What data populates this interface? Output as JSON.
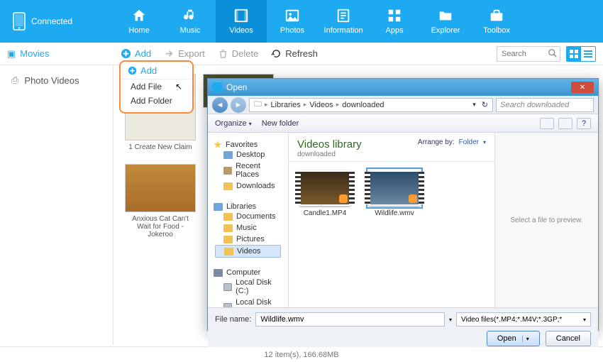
{
  "device": {
    "status": "Connected"
  },
  "nav": {
    "home": "Home",
    "music": "Music",
    "videos": "Videos",
    "photos": "Photos",
    "information": "Information",
    "apps": "Apps",
    "explorer": "Explorer",
    "toolbox": "Toolbox"
  },
  "sidebar": {
    "movies": "Movies",
    "photoVideos": "Photo Videos"
  },
  "toolbar": {
    "add": "Add",
    "export": "Export",
    "delete": "Delete",
    "refresh": "Refresh",
    "searchPlaceholder": "Search"
  },
  "addMenu": {
    "file": "Add File",
    "folder": "Add Folder"
  },
  "thumbs": {
    "item1": "1 Create New Claim",
    "item2": "Anxious Cat Can't Wait for Food - Jokeroo"
  },
  "dialog": {
    "title": "Open",
    "path": {
      "root": "Libraries",
      "p1": "Videos",
      "p2": "downloaded"
    },
    "searchPlaceholder": "Search downloaded",
    "organize": "Organize",
    "newFolder": "New folder",
    "side": {
      "favorites": "Favorites",
      "desktop": "Desktop",
      "recent": "Recent Places",
      "downloads": "Downloads",
      "libraries": "Libraries",
      "documents": "Documents",
      "music": "Music",
      "pictures": "Pictures",
      "videos": "Videos",
      "computer": "Computer",
      "diskC": "Local Disk (C:)",
      "diskD": "Local Disk (D:)"
    },
    "libTitle": "Videos library",
    "libSub": "downloaded",
    "arrangeBy": "Arrange by:",
    "arrangeVal": "Folder",
    "files": {
      "f1": "Candle1.MP4",
      "f2": "Wildlife.wmv"
    },
    "previewHint": "Select a file to preview.",
    "fileNameLabel": "File name:",
    "fileNameValue": "Wildlife.wmv",
    "filter": "Video files(*.MP4;*.M4V;*.3GP;*",
    "open": "Open",
    "cancel": "Cancel"
  },
  "status": "12 item(s), 166.68MB"
}
